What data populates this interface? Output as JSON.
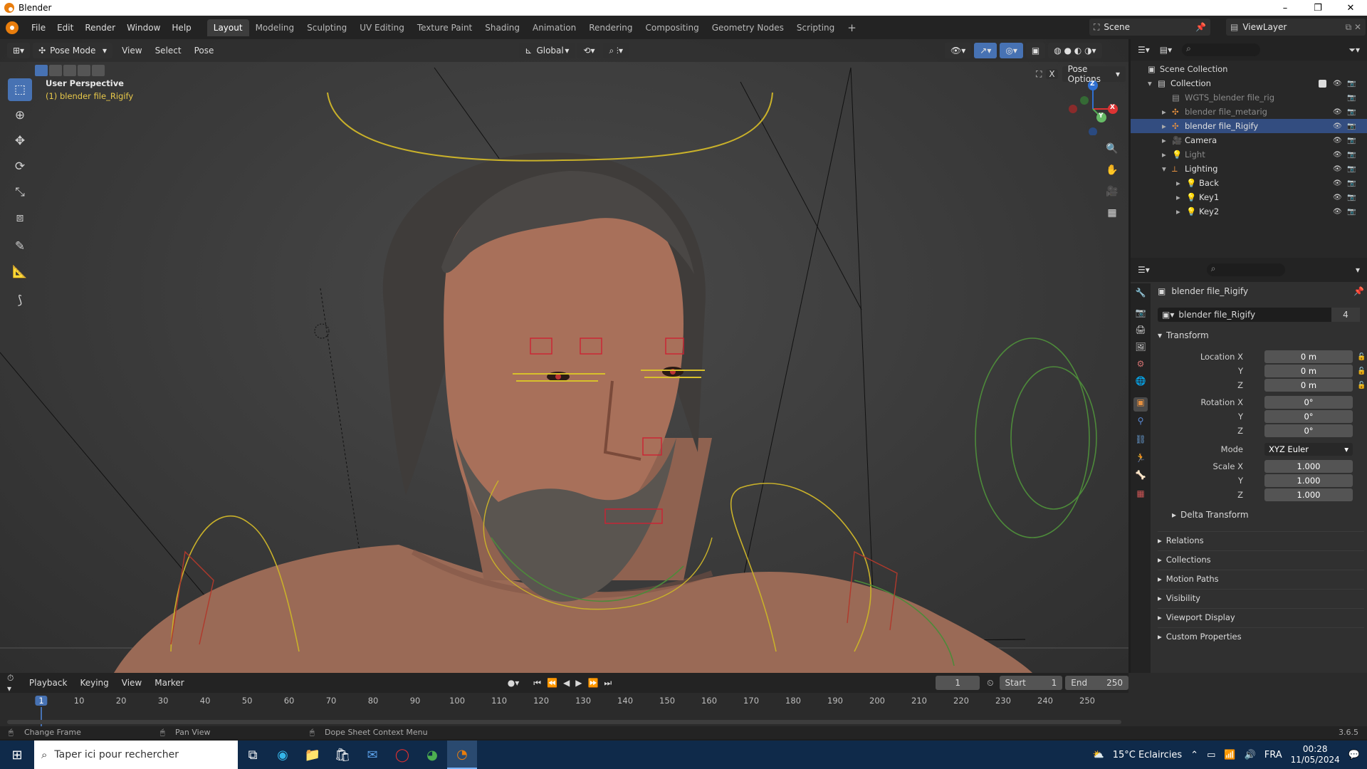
{
  "window": {
    "title": "Blender",
    "minimize": "–",
    "maximize": "❐",
    "close": "✕"
  },
  "menu": [
    "File",
    "Edit",
    "Render",
    "Window",
    "Help"
  ],
  "workspaces": [
    {
      "label": "Layout",
      "active": true
    },
    {
      "label": "Modeling"
    },
    {
      "label": "Sculpting"
    },
    {
      "label": "UV Editing"
    },
    {
      "label": "Texture Paint"
    },
    {
      "label": "Shading"
    },
    {
      "label": "Animation"
    },
    {
      "label": "Rendering"
    },
    {
      "label": "Compositing"
    },
    {
      "label": "Geometry Nodes"
    },
    {
      "label": "Scripting"
    },
    {
      "label": "+"
    }
  ],
  "scene": {
    "name": "Scene",
    "view_layer": "ViewLayer"
  },
  "viewport": {
    "mode": "Pose Mode",
    "menus": [
      "View",
      "Select",
      "Pose"
    ],
    "orientation": "Global",
    "pose_options": "Pose Options",
    "perspective_label": "User Perspective",
    "object_label": "(1) blender file_Rigify",
    "gizmo": {
      "x": "X",
      "y": "Y",
      "z": "Z"
    }
  },
  "outliner": {
    "root": "Scene Collection",
    "rows": [
      {
        "label": "Collection",
        "indent": 1,
        "expand": "▾"
      },
      {
        "label": "WGTS_blender file_rig",
        "indent": 2,
        "dim": true
      },
      {
        "label": "blender file_metarig",
        "indent": 2,
        "expand": "▸",
        "dim": true
      },
      {
        "label": "blender file_Rigify",
        "indent": 2,
        "expand": "▸",
        "selected": true
      },
      {
        "label": "Camera",
        "indent": 2,
        "expand": "▸"
      },
      {
        "label": "Light",
        "indent": 2,
        "expand": "▸",
        "dim": true
      },
      {
        "label": "Lighting",
        "indent": 2,
        "expand": "▾"
      },
      {
        "label": "Back",
        "indent": 3,
        "expand": "▸"
      },
      {
        "label": "Key1",
        "indent": 3,
        "expand": "▸"
      },
      {
        "label": "Key2",
        "indent": 3,
        "expand": "▸"
      }
    ]
  },
  "properties": {
    "object_name": "blender file_Rigify",
    "datablock": "blender file_Rigify",
    "users": "4",
    "transform_header": "Transform",
    "location": {
      "label": "Location X",
      "x": "0 m",
      "y": "0 m",
      "z": "0 m"
    },
    "rotation": {
      "label": "Rotation X",
      "x": "0°",
      "y": "0°",
      "z": "0°"
    },
    "mode_label": "Mode",
    "mode_value": "XYZ Euler",
    "scale": {
      "label": "Scale X",
      "x": "1.000",
      "y": "1.000",
      "z": "1.000"
    },
    "axis_y": "Y",
    "axis_z": "Z",
    "delta": "Delta Transform",
    "panels": [
      "Relations",
      "Collections",
      "Motion Paths",
      "Visibility",
      "Viewport Display",
      "Custom Properties"
    ]
  },
  "timeline": {
    "menus": [
      "Playback",
      "Keying",
      "View",
      "Marker"
    ],
    "current_frame": "1",
    "start_label": "Start",
    "start": "1",
    "end_label": "End",
    "end": "250",
    "ticks": [
      "1",
      "10",
      "20",
      "30",
      "40",
      "50",
      "60",
      "70",
      "80",
      "90",
      "100",
      "110",
      "120",
      "130",
      "140",
      "150",
      "160",
      "170",
      "180",
      "190",
      "200",
      "210",
      "220",
      "230",
      "240",
      "250"
    ]
  },
  "status": {
    "left": "Change Frame",
    "middle": "Pan View",
    "right": "Dope Sheet Context Menu",
    "version": "3.6.5"
  },
  "taskbar": {
    "search_placeholder": "Taper ici pour rechercher",
    "weather": "15°C  Eclaircies",
    "lang": "FRA",
    "time": "00:28",
    "date": "11/05/2024"
  }
}
